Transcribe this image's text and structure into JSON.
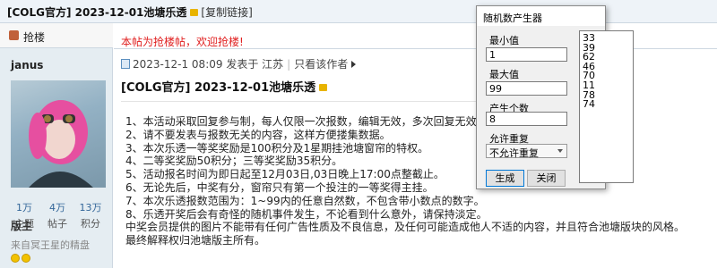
{
  "topbar": {
    "title": "[COLG官方] 2023-12-01池塘乐透",
    "copy_link": "[复制链接]"
  },
  "sidebar": {
    "reply_label": "抢楼",
    "username": "janus",
    "stats": [
      {
        "num": "1万",
        "label": "主题"
      },
      {
        "num": "4万",
        "label": "帖子"
      },
      {
        "num": "13万",
        "label": "积分"
      }
    ],
    "group_label": "版主",
    "group_desc": "来自冥王星的精盘"
  },
  "main": {
    "notice": "本帖为抢楼帖，欢迎抢楼!",
    "meta": {
      "posted": "2023-12-1 08:09 发表于 江苏",
      "only_author": "只看该作者"
    },
    "post_title": "[COLG官方] 2023-12-01池塘乐透",
    "body_lines": [
      "1、本活动采取回复参与制，每人仅限一次报数，编辑无效，多次回复无效。",
      "2、请不要发表与报数无关的内容，这样方便搂集数据。",
      "3、本次乐透一等奖奖励是100积分及1星期挂池塘窗帘的特权。",
      "4、二等奖奖励50积分；三等奖奖励35积分。",
      "5、活动报名时间为即日起至12月03日,03日晚上17:00点整截止。",
      "6、无论先后，中奖有分，窗帘只有第一个投注的一等奖得主挂。",
      "7、本次乐透报数范围为：1~99内的任意自然数，不包含带小数点的数字。",
      "8、乐透开奖后会有奇怪的随机事件发生，不论看到什么意外，请保持淡定。",
      "中奖会员提供的图片不能带有任何广告性质及不良信息，及任何可能造成他人不适的内容，并且符合池塘版块的风格。",
      "最终解释权归池塘版主所有。"
    ]
  },
  "dialog": {
    "title": "随机数产生器",
    "min_label": "最小值",
    "min_value": "1",
    "max_label": "最大值",
    "max_value": "99",
    "count_label": "产生个数",
    "count_value": "8",
    "repeat_label": "允许重复",
    "repeat_value": "不允许重复",
    "generate_label": "生成",
    "close_label": "关闭",
    "results": [
      "33",
      "39",
      "62",
      "46",
      "70",
      "11",
      "78",
      "74"
    ]
  },
  "colors": {
    "notice_red": "#e02020",
    "sidebar_bg": "#e5edf2",
    "topbar_bg": "#eef3f8"
  }
}
